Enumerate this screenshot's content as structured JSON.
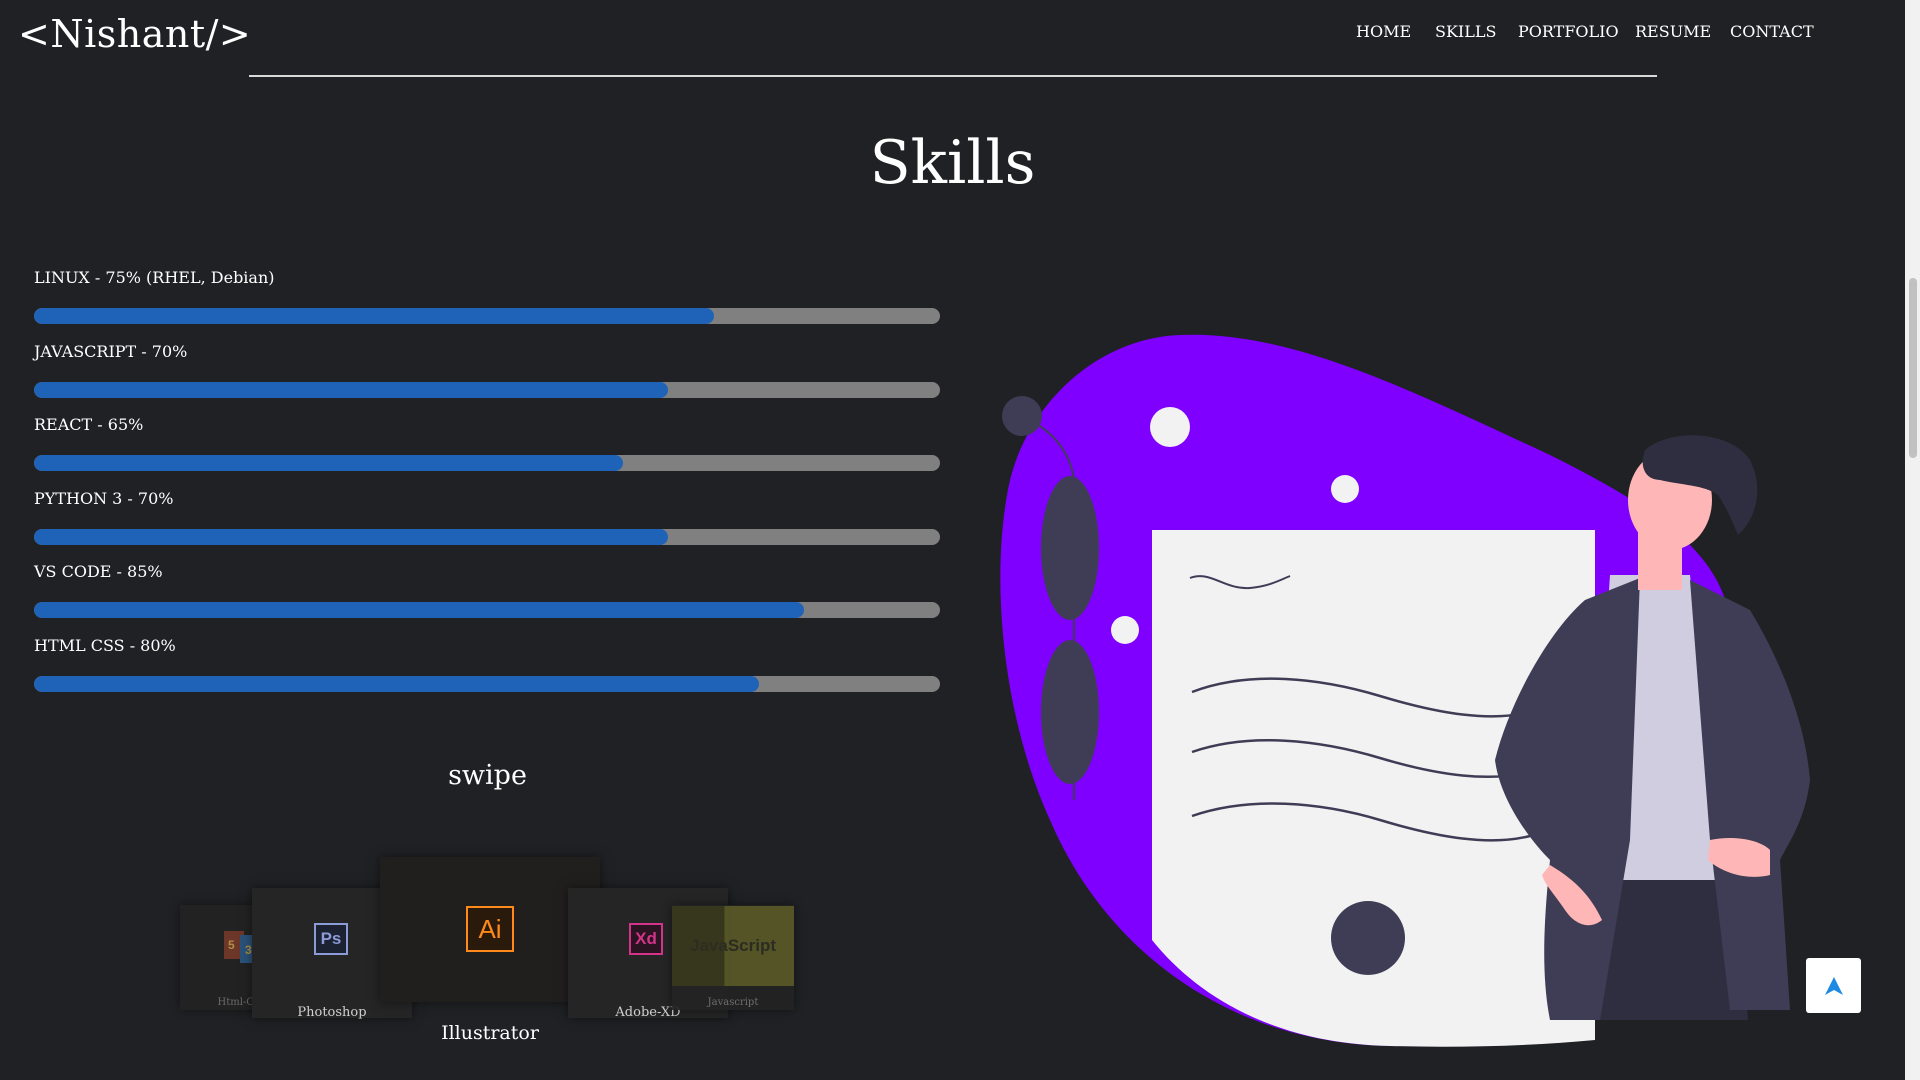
{
  "brand": "<Nishant/>",
  "nav": [
    "HOME",
    "SKILLS",
    "PORTFOLIO",
    "RESUME",
    "CONTACT"
  ],
  "section_title": "Skills",
  "skills": [
    {
      "label": "LINUX - 75% (RHEL, Debian)",
      "percent": 75
    },
    {
      "label": "JAVASCRIPT - 70%",
      "percent": 70
    },
    {
      "label": "REACT - 65%",
      "percent": 65
    },
    {
      "label": "PYTHON 3 - 70%",
      "percent": 70
    },
    {
      "label": "VS CODE - 85%",
      "percent": 85
    },
    {
      "label": "HTML CSS - 80%",
      "percent": 80
    }
  ],
  "colors": {
    "background": "#1f2124",
    "bar_fill": "#1e63b8",
    "bar_track": "#808080",
    "blob": "#8000ff",
    "figure_dark": "#403557"
  },
  "swipe_label": "swipe",
  "carousel": [
    {
      "name": "Html-CSS",
      "logo": "html-css-logo"
    },
    {
      "name": "Photoshop",
      "logo": "Ps"
    },
    {
      "name": "Illustrator",
      "logo": "Ai"
    },
    {
      "name": "Adobe-XD",
      "logo": "Xd"
    },
    {
      "name": "Javascript",
      "logo": "JavaScript"
    }
  ],
  "icons": {
    "scroll_top": "arrow-up-icon"
  }
}
